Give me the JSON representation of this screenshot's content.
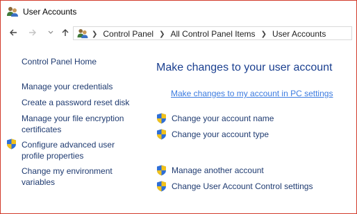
{
  "window": {
    "title": "User Accounts",
    "border_color": "#d23a2a"
  },
  "nav": {
    "back_icon": "arrow-left-icon",
    "forward_icon": "arrow-right-icon",
    "recent_icon": "chevron-down-icon",
    "up_icon": "arrow-up-icon"
  },
  "address": {
    "icon": "user-accounts-icon",
    "crumbs": [
      "Control Panel",
      "All Control Panel Items",
      "User Accounts"
    ]
  },
  "sidebar": {
    "home": "Control Panel Home",
    "items": [
      {
        "label": "Manage your credentials",
        "shield": false
      },
      {
        "label": "Create a password reset disk",
        "shield": false
      },
      {
        "label_line1": "Manage your file encryption",
        "label_line2": "certificates",
        "shield": false
      },
      {
        "label_line1": "Configure advanced user",
        "label_line2": "profile properties",
        "shield": true
      },
      {
        "label_line1": "Change my environment",
        "label_line2": "variables",
        "shield": false
      }
    ]
  },
  "main": {
    "heading": "Make changes to your user account",
    "pc_settings_link": "Make changes to my account in PC settings",
    "tasks": [
      {
        "label": "Change your account name",
        "icon": "uac-shield-icon"
      },
      {
        "label": "Change your account type",
        "icon": "uac-shield-icon"
      },
      {
        "label": "Manage another account",
        "icon": "uac-shield-icon"
      },
      {
        "label": "Change User Account Control settings",
        "icon": "uac-shield-icon"
      }
    ]
  },
  "colors": {
    "heading": "#1a3f8f",
    "link": "#1e3a70",
    "pc_link": "#3b7be0",
    "shield_blue": "#2f6fd6",
    "shield_yellow": "#f2c21b"
  }
}
